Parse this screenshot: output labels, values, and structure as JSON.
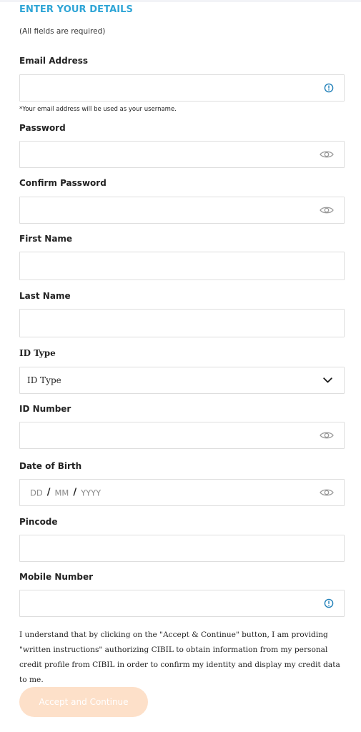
{
  "form": {
    "title": "ENTER YOUR DETAILS",
    "subtitle": "(All fields are required)",
    "fields": {
      "email": {
        "label": "Email Address",
        "value": "",
        "helper": "*Your email address will be used as your username.",
        "icon": "info-icon"
      },
      "password": {
        "label": "Password",
        "value": "",
        "icon": "eye-icon"
      },
      "confirm_password": {
        "label": "Confirm Password",
        "value": "",
        "icon": "eye-icon"
      },
      "first_name": {
        "label": "First Name",
        "value": ""
      },
      "last_name": {
        "label": "Last Name",
        "value": ""
      },
      "id_type": {
        "label": "ID Type",
        "selected": "ID Type",
        "icon": "chevron-down-icon"
      },
      "id_number": {
        "label": "ID Number",
        "value": "",
        "icon": "eye-icon"
      },
      "dob": {
        "label": "Date of Birth",
        "dd": "DD",
        "mm": "MM",
        "yyyy": "YYYY",
        "separator": "/",
        "icon": "eye-icon"
      },
      "pincode": {
        "label": "Pincode",
        "value": ""
      },
      "mobile": {
        "label": "Mobile Number",
        "value": "",
        "icon": "info-icon"
      }
    },
    "consent": "I understand that by clicking on the \"Accept & Continue\" button, I am providing \"written instructions\" authorizing CIBIL to obtain information from my personal credit profile from CIBIL in order to confirm my identity and display my credit data to me.",
    "submit_label": "Accept and Continue"
  },
  "colors": {
    "title": "#2fa5d6",
    "info_icon": "#1f7fb8",
    "eye_icon": "#9a9a9a",
    "button_disabled": "#fde0c9"
  }
}
